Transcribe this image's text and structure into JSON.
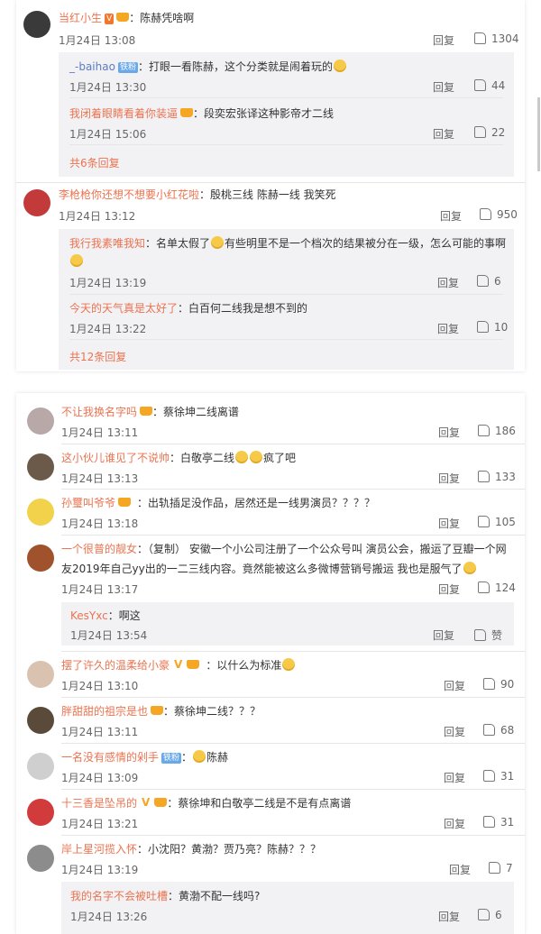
{
  "panel1": {
    "c1": {
      "name": "当红小生",
      "badge": "V",
      "text": "陈赫凭啥啊",
      "time": "1月24日 13:08",
      "reply": "回复",
      "likes": "1304"
    },
    "c1_r1": {
      "name": "_-baihao",
      "badge": "铁粉",
      "text": "打眼一看陈赫，这个分类就是闹着玩的",
      "time": "1月24日 13:30",
      "reply": "回复",
      "likes": "44"
    },
    "c1_r2": {
      "name": "我闭着眼睛看着你装逼",
      "text": "段奕宏张译这种影帝才二线",
      "time": "1月24日 15:06",
      "reply": "回复",
      "likes": "22"
    },
    "c1_more": "共6条回复",
    "c2": {
      "name": "李枪枪你还想不想要小红花啦",
      "text": "殷桃三线 陈赫一线 我笑死",
      "time": "1月24日 13:12",
      "reply": "回复",
      "likes": "950"
    },
    "c2_r1": {
      "name": "我行我素唯我知",
      "text1": "名单太假了",
      "text2": "有些明里不是一个档次的结果被分在一级，怎么可能的事啊",
      "time": "1月24日 13:19",
      "reply": "回复",
      "likes": "6"
    },
    "c2_r2": {
      "name": "今天的天气真是太好了",
      "text": "白百何二线我是想不到的",
      "time": "1月24日 13:22",
      "reply": "回复",
      "likes": "10"
    },
    "c2_more": "共12条回复"
  },
  "panel2": {
    "c1": {
      "name": "不让我换名字吗",
      "text": "蔡徐坤二线离谱",
      "time": "1月24日 13:11",
      "reply": "回复",
      "likes": "186"
    },
    "c2": {
      "name": "这小伙儿谁见了不说帅",
      "text1": "白敬亭二线",
      "text2": "疯了吧",
      "time": "1月24日 13:13",
      "reply": "回复",
      "likes": "133"
    },
    "c3": {
      "name": "孙璽叫爷爷",
      "text": "出轨插足没作品，居然还是一线男演员？？？？",
      "time": "1月24日 13:18",
      "reply": "回复",
      "likes": "105"
    },
    "c4": {
      "name": "一个很普的靓女",
      "text1": "（复制） 安徽一个小公司注册了一个公众号叫 演员公会，搬运了豆瓣一个网",
      "text2": "友2019年自己yy出的一二三线内容。竟然能被这么多微博营销号搬运 我也是服气了",
      "time": "1月24日 13:17",
      "reply": "回复",
      "likes": "124"
    },
    "c4_r1": {
      "name": "KesYxc",
      "text": "啊这",
      "time": "1月24日 13:54",
      "reply": "回复",
      "likes": "赞"
    },
    "c5": {
      "name": "摆了许久的温柔给小豪",
      "text": "以什么为标准",
      "time": "1月24日 13:10",
      "reply": "回复",
      "likes": "90"
    },
    "c6": {
      "name": "胖甜甜的祖宗是也",
      "text": "蔡徐坤二线？？？",
      "time": "1月24日 13:11",
      "reply": "回复",
      "likes": "68"
    },
    "c7": {
      "name": "一名没有感情的剁手",
      "badge": "铁粉",
      "text": "陈赫",
      "time": "1月24日 13:09",
      "reply": "回复",
      "likes": "31"
    },
    "c8": {
      "name": "十三香是坠吊的",
      "text": "蔡徐坤和白敬亭二线是不是有点离谱",
      "time": "1月24日 13:21",
      "reply": "回复",
      "likes": "31"
    },
    "c9": {
      "name": "岸上星河揽入怀",
      "text": "小沈阳？黄渤？贾乃亮？陈赫？？？",
      "time": "1月24日 13:19",
      "reply": "回复",
      "likes": "7"
    },
    "c9_r1": {
      "name": "我的名字不会被吐槽",
      "text": "黄渤不配一线吗?",
      "time": "1月24日 13:26",
      "reply": "回复",
      "likes": "6"
    }
  },
  "colors": {
    "name": "#eb7350",
    "accent": "#f3762c",
    "sub_bg": "#f2f2f5"
  },
  "icons": [
    "avatar",
    "thumb-up-icon",
    "emoji-icon",
    "vip-crown-icon"
  ]
}
